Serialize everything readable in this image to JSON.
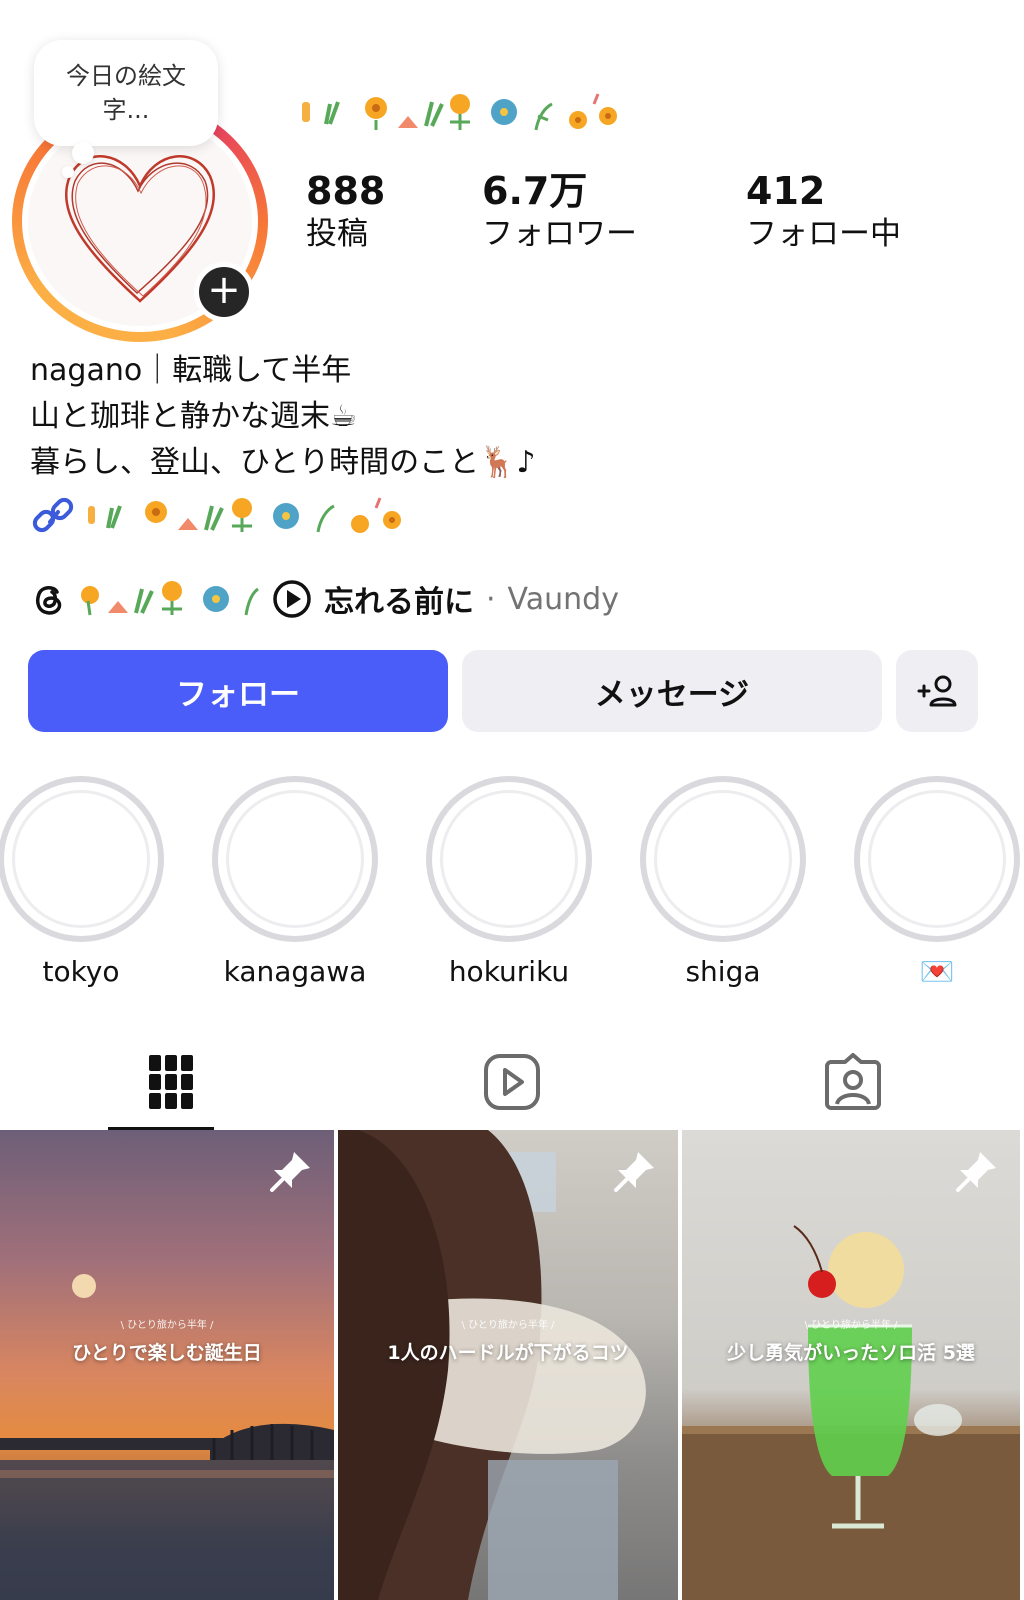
{
  "note": {
    "text": "今日の絵文字..."
  },
  "profile": {
    "stats": [
      {
        "value": "888",
        "label": "投稿"
      },
      {
        "value": "6.7万",
        "label": "フォロワー"
      },
      {
        "value": "412",
        "label": "フォロー中"
      }
    ],
    "bio_lines": [
      "nagano｜転職して半年",
      "山と珈琲と静かな週末☕",
      "暮らし、登山、ひとり時間のこと🦌♪"
    ],
    "music": {
      "title": "忘れる前に",
      "separator": "·",
      "artist": "Vaundy"
    }
  },
  "buttons": {
    "follow": "フォロー",
    "message": "メッセージ"
  },
  "highlights": [
    {
      "label": "tokyo"
    },
    {
      "label": "kanagawa"
    },
    {
      "label": "hokuriku"
    },
    {
      "label": "shiga"
    },
    {
      "label": "💌"
    }
  ],
  "tabs": [
    {
      "icon": "grid-icon",
      "active": true
    },
    {
      "icon": "reels-icon",
      "active": false
    },
    {
      "icon": "tagged-icon",
      "active": false
    }
  ],
  "posts": [
    {
      "subtitle": "\\ ひとり旅から半年 /",
      "title": "ひとりで楽しむ誕生日",
      "pinned": true
    },
    {
      "subtitle": "\\ ひとり旅から半年 /",
      "title": "1人のハードルが下がるコツ",
      "pinned": true
    },
    {
      "subtitle": "\\ ひとり旅から半年 /",
      "title": "少し勇気がいったソロ活 5選",
      "pinned": true
    }
  ],
  "colors": {
    "follow_button": "#4a5df9",
    "secondary_button": "#efeff3",
    "story_ring_start": "#e1306c",
    "story_ring_end": "#fcaf45"
  }
}
